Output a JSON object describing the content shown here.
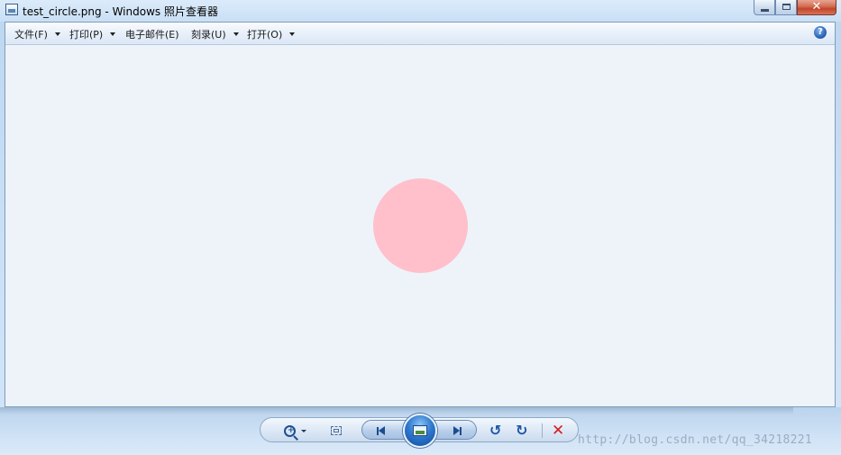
{
  "window": {
    "title": "test_circle.png - Windows 照片查看器",
    "controls": {
      "minimize": "minimize-icon",
      "maximize": "maximize-icon",
      "close": "✕"
    }
  },
  "menubar": {
    "items": [
      {
        "label": "文件(F)",
        "has_dropdown": true
      },
      {
        "label": "打印(P)",
        "has_dropdown": true
      },
      {
        "label": "电子邮件(E)",
        "has_dropdown": false
      },
      {
        "label": "刻录(U)",
        "has_dropdown": true
      },
      {
        "label": "打开(O)",
        "has_dropdown": true
      }
    ],
    "help_glyph": "?"
  },
  "viewer": {
    "image_shape": "circle",
    "image_color": "#ffc0cb",
    "background_color": "#eef3fa"
  },
  "toolbar": {
    "buttons": [
      {
        "name": "zoom",
        "icon": "zoom-icon",
        "has_dropdown": true
      },
      {
        "name": "actual-size",
        "icon": "fit-window-icon"
      },
      {
        "name": "previous",
        "icon": "previous-icon"
      },
      {
        "name": "slideshow",
        "icon": "slideshow-icon"
      },
      {
        "name": "next",
        "icon": "next-icon"
      },
      {
        "name": "rotate-counterclockwise",
        "icon": "rotate-left-icon",
        "glyph": "↺"
      },
      {
        "name": "rotate-clockwise",
        "icon": "rotate-right-icon",
        "glyph": "↻"
      },
      {
        "name": "delete",
        "icon": "delete-icon",
        "glyph": "✕"
      }
    ]
  },
  "watermark": "http://blog.csdn.net/qq_34218221"
}
